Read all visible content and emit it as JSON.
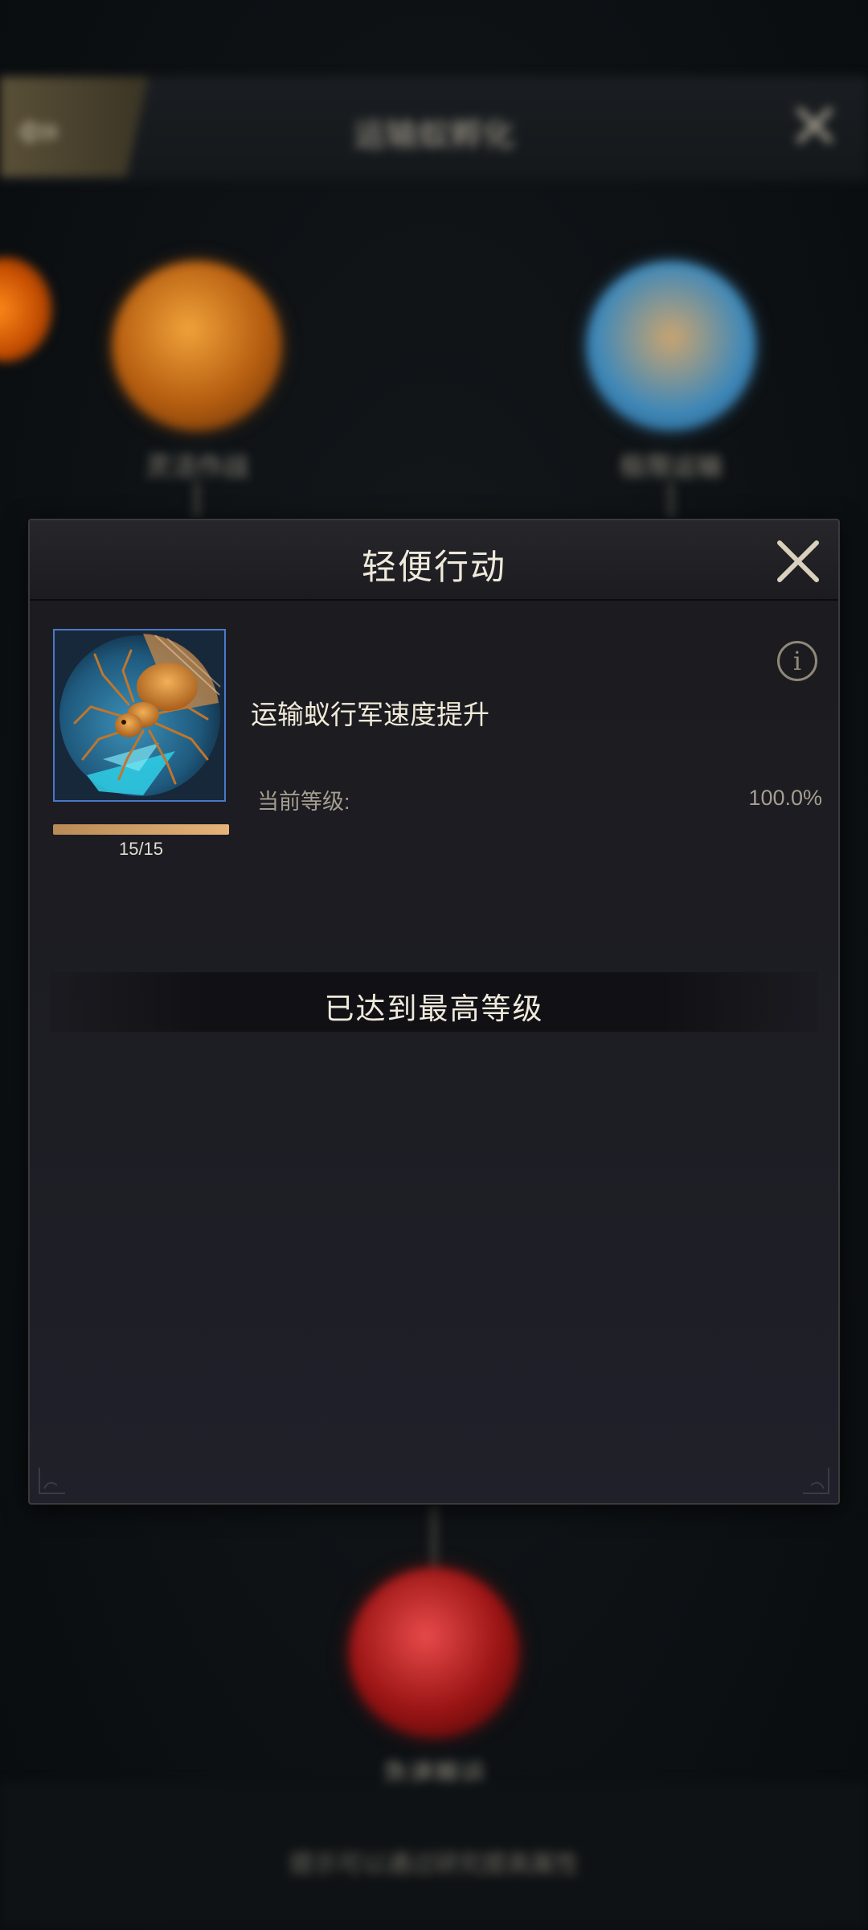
{
  "background": {
    "title": "运输蚁孵化",
    "left_node_label": "灵活作战",
    "right_node_label": "极限运输",
    "bottom_node_label": "急速搬运",
    "footer_hint": "提示可以通过研究提高属性"
  },
  "dialog": {
    "title": "轻便行动",
    "skill": {
      "icon": "ant-skill-icon",
      "level_text": "15/15",
      "progress": 1.0,
      "effect_name": "运输蚁行军速度提升",
      "current_level_label": "当前等级:",
      "current_level_value": "100.0%"
    },
    "max_level_text": "已达到最高等级"
  },
  "colors": {
    "accent_gold": "#e6b47a",
    "frame_blue": "#4a78c8",
    "text_light": "#efe9dc",
    "text_muted": "#a59e90"
  }
}
